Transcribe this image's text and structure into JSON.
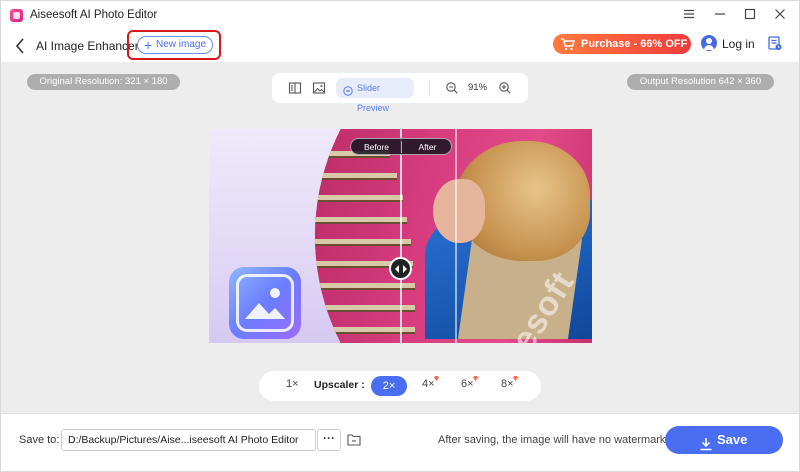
{
  "window": {
    "title": "Aiseesoft AI Photo Editor"
  },
  "header": {
    "page_title": "AI Image Enhancer",
    "new_image_label": "New image",
    "purchase_label": "Purchase - 66% OFF",
    "login_label": "Log in"
  },
  "resolution": {
    "original": "Original Resolution: 321 × 180",
    "output": "Output Resolution 642 × 360"
  },
  "toolbar": {
    "slider_preview_label": "Slider Preview",
    "zoom_level": "91%"
  },
  "preview": {
    "before_label": "Before",
    "after_label": "After",
    "watermark_text": "aiseesoft",
    "slider_position": 0.5
  },
  "upscaler": {
    "label": "Upscaler :",
    "options": [
      "1×",
      "2×",
      "4×",
      "6×",
      "8×"
    ],
    "selected": "2×"
  },
  "footer": {
    "save_to_label": "Save to:",
    "path": "D:/Backup/Pictures/Aise...iseesoft AI Photo Editor",
    "more_label": "···",
    "note": "After saving, the image will have no watermark.",
    "save_label": "Save"
  },
  "colors": {
    "accent": "#4a6ef2",
    "purchase_gradient_start": "#ff7a3d",
    "purchase_gradient_end": "#f03c3c",
    "highlight_border": "#d6171c"
  }
}
